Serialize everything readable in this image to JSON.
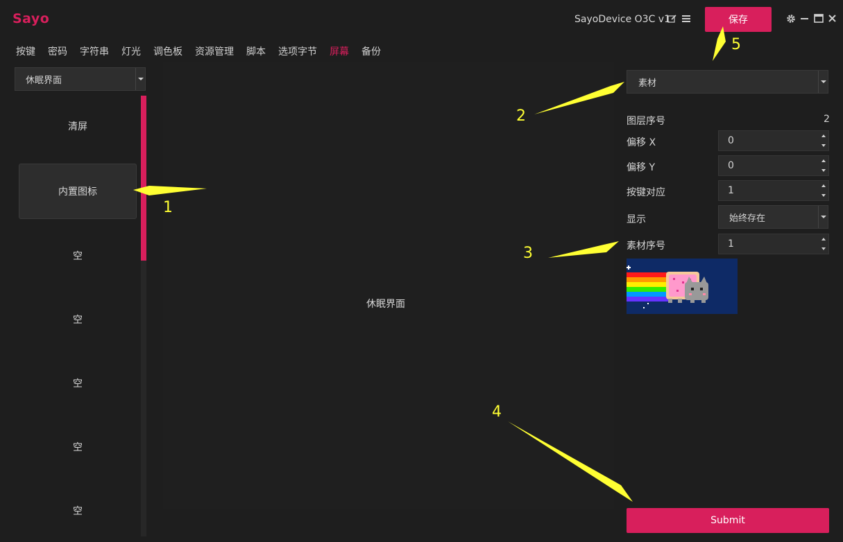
{
  "app": {
    "logo": "Sayo",
    "device_title": "SayoDevice O3C v1",
    "save_label": "保存",
    "icons": [
      "edit-icon",
      "menu-icon",
      "gear-icon",
      "minimize-icon",
      "maximize-icon",
      "close-icon"
    ]
  },
  "tabs": [
    {
      "label": "按键",
      "active": false
    },
    {
      "label": "密码",
      "active": false
    },
    {
      "label": "字符串",
      "active": false
    },
    {
      "label": "灯光",
      "active": false
    },
    {
      "label": "调色板",
      "active": false
    },
    {
      "label": "资源管理",
      "active": false
    },
    {
      "label": "脚本",
      "active": false
    },
    {
      "label": "选项字节",
      "active": false
    },
    {
      "label": "屏幕",
      "active": true
    },
    {
      "label": "备份",
      "active": false
    }
  ],
  "left": {
    "screen_select": "休眠界面",
    "layers": [
      "清屏",
      "内置图标",
      "空",
      "空",
      "空",
      "空",
      "空"
    ],
    "selected_index": 1
  },
  "center": {
    "label": "休眠界面"
  },
  "right": {
    "type_select": "素材",
    "layer_index_label": "图层序号",
    "layer_index_value": "2",
    "offset_x_label": "偏移 X",
    "offset_x_value": "0",
    "offset_y_label": "偏移 Y",
    "offset_y_value": "0",
    "key_map_label": "按键对应",
    "key_map_value": "1",
    "display_label": "显示",
    "display_value": "始终存在",
    "asset_index_label": "素材序号",
    "asset_index_value": "1",
    "submit_label": "Submit"
  },
  "annotations": [
    "1",
    "2",
    "3",
    "4",
    "5"
  ],
  "colors": {
    "accent": "#d81f5c",
    "background": "#1e1e1e",
    "annotation": "#ffff33"
  }
}
